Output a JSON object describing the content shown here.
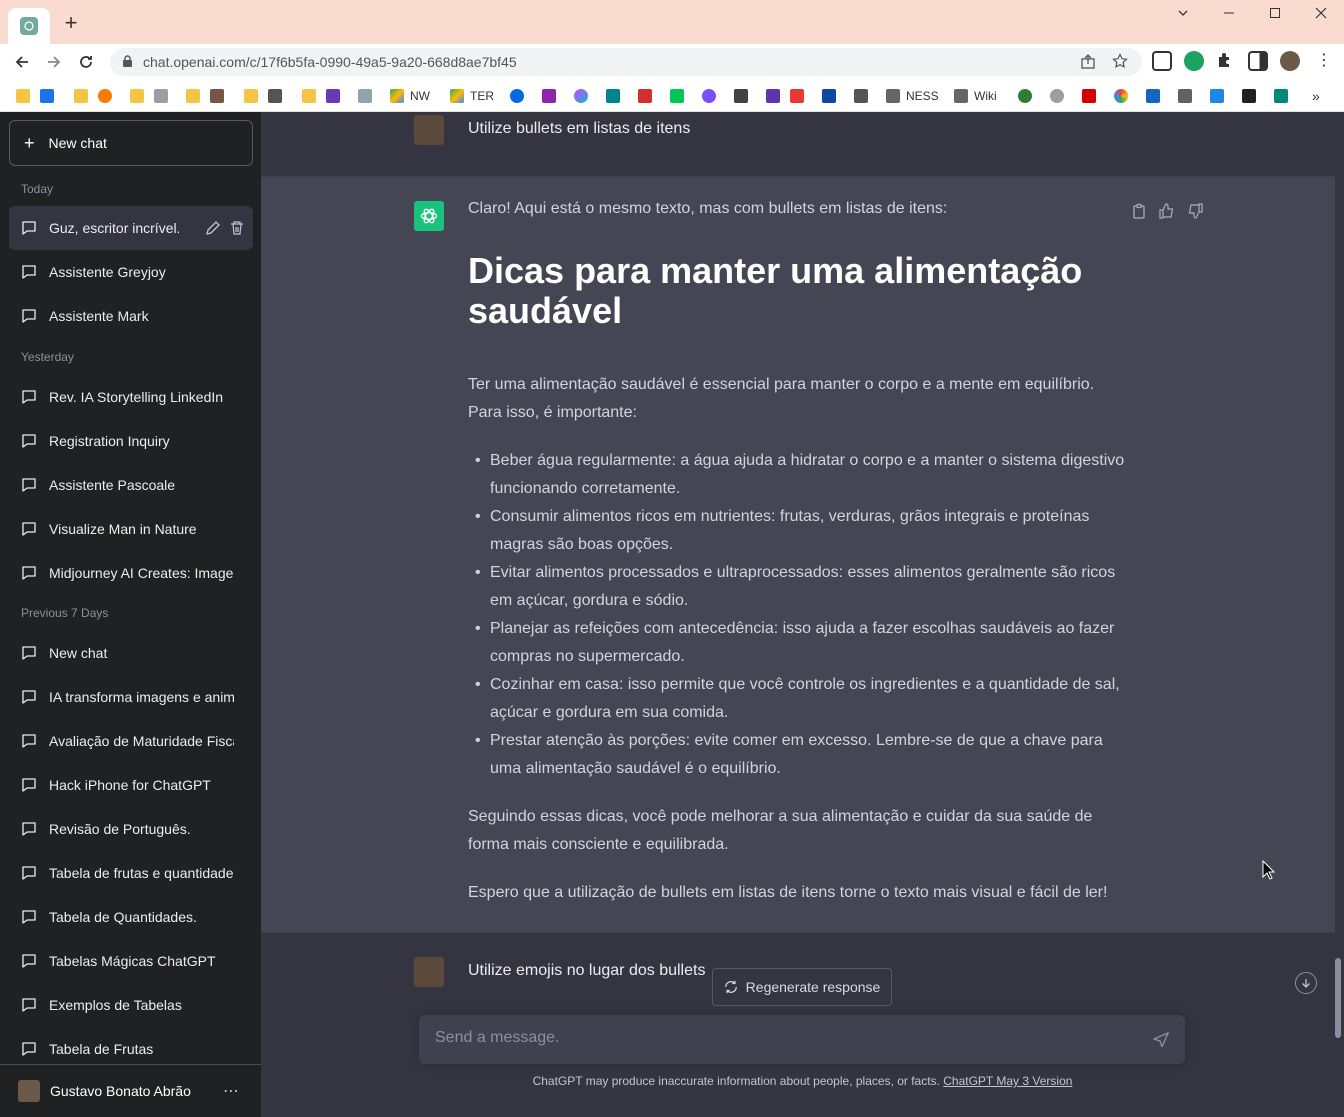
{
  "browser": {
    "url": "chat.openai.com/c/17f6b5fa-0990-49a5-9a20-668d8ae7bf45",
    "bookmarks": [
      "NW",
      "TER",
      "NESS",
      "Wiki"
    ]
  },
  "sidebar": {
    "new_chat_label": "New chat",
    "sections": {
      "today": "Today",
      "yesterday": "Yesterday",
      "previous7": "Previous 7 Days"
    },
    "today_items": [
      "Guz, escritor incrível.",
      "Assistente Greyjoy",
      "Assistente Mark"
    ],
    "yesterday_items": [
      "Rev. IA Storytelling LinkedIn",
      "Registration Inquiry",
      "Assistente Pascoale",
      "Visualize Man in Nature",
      "Midjourney AI Creates: Image"
    ],
    "previous_items": [
      "New chat",
      "IA transforma imagens e anim",
      "Avaliação de Maturidade Fisca",
      "Hack iPhone for ChatGPT",
      "Revisão de Português.",
      "Tabela de frutas e quantidade",
      "Tabela de Quantidades.",
      "Tabelas Mágicas ChatGPT",
      "Exemplos de Tabelas",
      "Tabela de Frutas"
    ],
    "user_name": "Gustavo Bonato Abrão"
  },
  "conversation": {
    "user_msg_1": "Utilize bullets em listas de itens",
    "ai_intro": "Claro! Aqui está o mesmo texto, mas com bullets em listas de itens:",
    "ai_heading": "Dicas para manter uma alimentação saudável",
    "ai_paragraph_1": "Ter uma alimentação saudável é essencial para manter o corpo e a mente em equilíbrio. Para isso, é importante:",
    "ai_bullets": [
      "Beber água regularmente: a água ajuda a hidratar o corpo e a manter o sistema digestivo funcionando corretamente.",
      "Consumir alimentos ricos em nutrientes: frutas, verduras, grãos integrais e proteínas magras são boas opções.",
      "Evitar alimentos processados e ultraprocessados: esses alimentos geralmente são ricos em açúcar, gordura e sódio.",
      "Planejar as refeições com antecedência: isso ajuda a fazer escolhas saudáveis ao fazer compras no supermercado.",
      "Cozinhar em casa: isso permite que você controle os ingredientes e a quantidade de sal, açúcar e gordura em sua comida.",
      "Prestar atenção às porções: evite comer em excesso. Lembre-se de que a chave para uma alimentação saudável é o equilíbrio."
    ],
    "ai_paragraph_2": "Seguindo essas dicas, você pode melhorar a sua alimentação e cuidar da sua saúde de forma mais consciente e equilibrada.",
    "ai_paragraph_3": "Espero que a utilização de bullets em listas de itens torne o texto mais visual e fácil de ler!",
    "user_msg_2": "Utilize emojis no lugar dos bullets"
  },
  "regenerate_label": "Regenerate response",
  "composer": {
    "placeholder": "Send a message."
  },
  "footer": {
    "text": "ChatGPT may produce inaccurate information about people, places, or facts.",
    "link": "ChatGPT May 3 Version"
  },
  "colors": {
    "accent": "#19c37d",
    "sidebar": "#202123",
    "main": "#343541",
    "ai_row": "#444654"
  }
}
